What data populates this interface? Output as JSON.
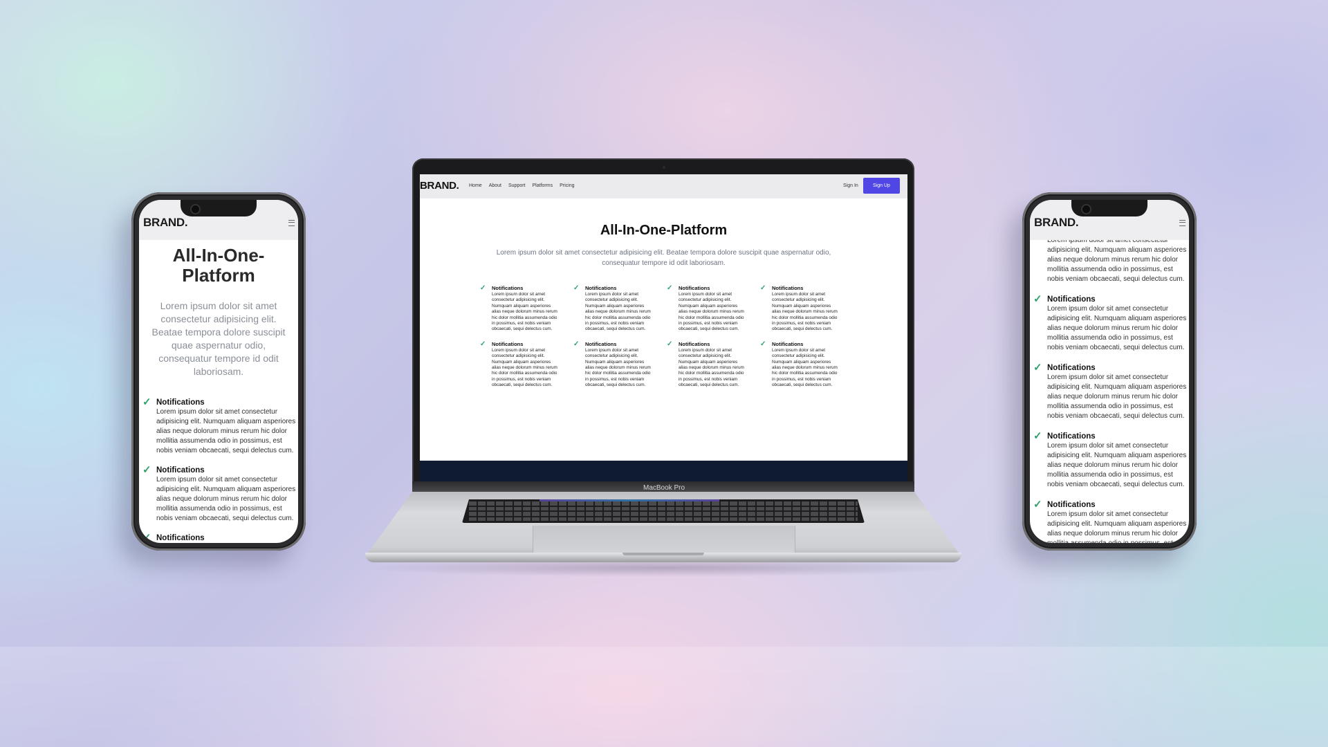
{
  "brand": "BRAND.",
  "device_label": "MacBook Pro",
  "desktop": {
    "nav_links": [
      "Home",
      "About",
      "Support",
      "Platforms",
      "Pricing"
    ],
    "sign_in": "Sign In",
    "sign_up": "Sign Up",
    "title": "All-In-One-Platform",
    "lead": "Lorem ipsum dolor sit amet consectetur adipisicing elit. Beatae tempora dolore suscipit quae aspernatur odio, consequatur tempore id odit laboriosam."
  },
  "mobile": {
    "title_line1": "All-In-One-",
    "title_line2": "Platform",
    "lead": "Lorem ipsum dolor sit amet consectetur adipisicing elit. Beatae tempora dolore suscipit quae aspernatur odio, consequatur tempore id odit laboriosam."
  },
  "feature": {
    "title": "Notifications",
    "text": "Lorem ipsum dolor sit amet consectetur adipisicing elit. Numquam aliquam asperiores alias neque dolorum minus rerum hic dolor mollitia assumenda odio in possimus, est nobis veniam obcaecati, sequi delectus cum."
  },
  "colors": {
    "accent": "#4f46e5",
    "check": "#2fa16a"
  },
  "icons": {
    "check": "✓",
    "menu": "hamburger-menu-icon"
  }
}
